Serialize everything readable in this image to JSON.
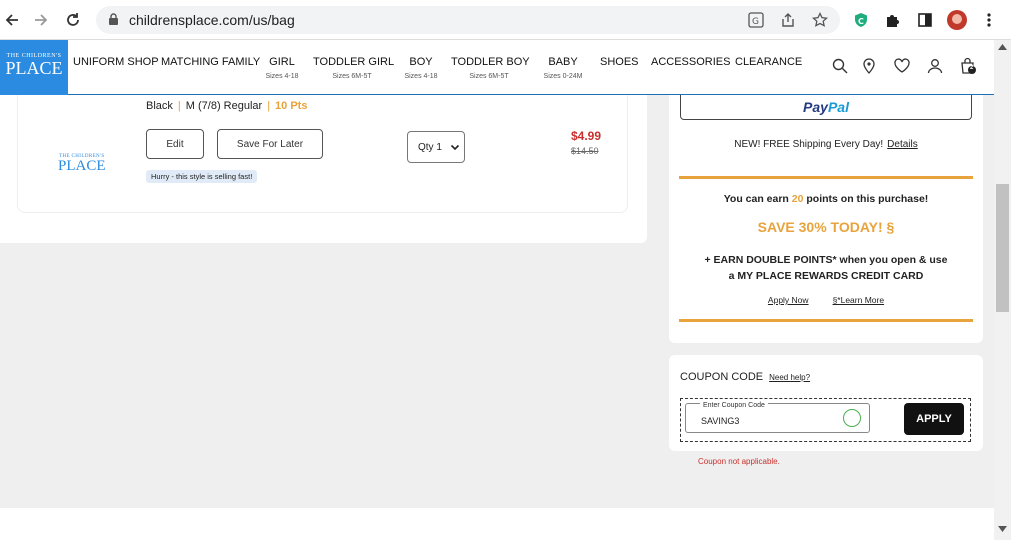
{
  "browser": {
    "url": "childrensplace.com/us/bag"
  },
  "nav": {
    "logo_line1": "THE CHILDREN'S",
    "logo_line2": "PLACE",
    "items": [
      {
        "label": "UNIFORM SHOP",
        "sub": ""
      },
      {
        "label": "MATCHING FAMILY",
        "sub": ""
      },
      {
        "label": "GIRL",
        "sub": "Sizes 4-18"
      },
      {
        "label": "TODDLER GIRL",
        "sub": "Sizes 6M-5T"
      },
      {
        "label": "BOY",
        "sub": "Sizes 4-18"
      },
      {
        "label": "TODDLER BOY",
        "sub": "Sizes 6M-5T"
      },
      {
        "label": "BABY",
        "sub": "Sizes 0-24M"
      },
      {
        "label": "SHOES",
        "sub": ""
      },
      {
        "label": "ACCESSORIES",
        "sub": ""
      },
      {
        "label": "CLEARANCE",
        "sub": ""
      }
    ],
    "cart_count": "2"
  },
  "item": {
    "color": "Black",
    "size": "M (7/8) Regular",
    "points": "10 Pts",
    "edit_label": "Edit",
    "save_later_label": "Save For Later",
    "hurry": "Hurry -  this style is selling fast!",
    "qty": "Qty 1",
    "price": "$4.99",
    "old_price": "$14.50"
  },
  "summary": {
    "paypal_a": "Pay",
    "paypal_b": "Pal",
    "shipping": "NEW! FREE Shipping Every Day!",
    "details": "Details",
    "earn_pre": "You can earn ",
    "earn_num": "20",
    "earn_post": " points on this purchase!",
    "save": "SAVE 30% TODAY! §",
    "double_line1": "+ EARN DOUBLE POINTS* when you open & use",
    "double_line2": "a MY PLACE REWARDS CREDIT CARD",
    "apply_now": "Apply Now",
    "learn_more": "§*Learn More"
  },
  "coupon": {
    "title": "COUPON CODE",
    "help": "Need help?",
    "input_label": "Enter Coupon Code",
    "value": "SAVING3",
    "apply": "APPLY",
    "error": "Coupon not applicable."
  },
  "colors": {
    "brand_blue": "#2a8be0",
    "accent_orange": "#e8a33d",
    "price_red": "#c9302c"
  }
}
